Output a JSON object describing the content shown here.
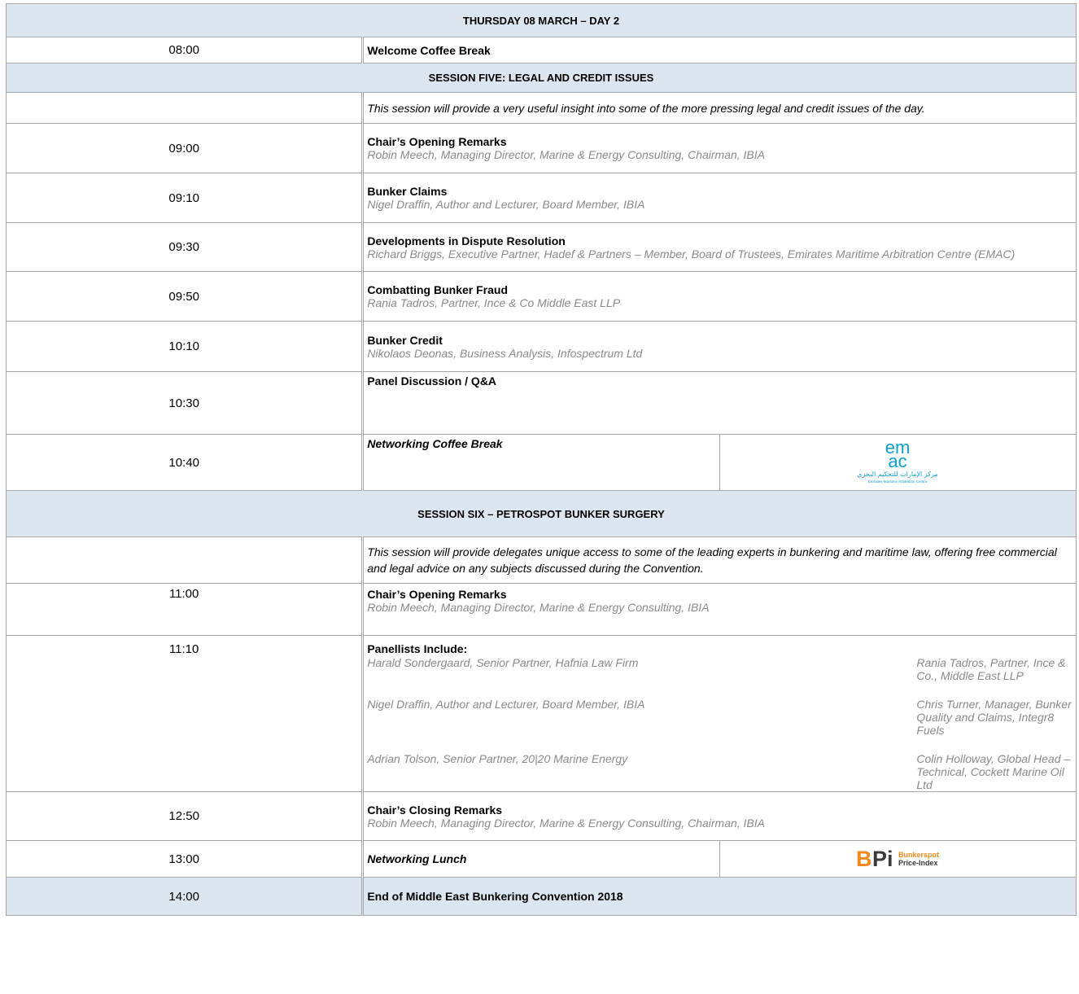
{
  "agenda": {
    "day_header": "THURSDAY 08 MARCH – DAY 2",
    "welcome": {
      "time": "08:00",
      "title": "Welcome Coffee Break"
    },
    "session5": {
      "header": "SESSION FIVE: LEGAL AND CREDIT ISSUES",
      "description": "This session will provide a very useful insight into some of the more pressing legal and credit issues of the day.",
      "items": [
        {
          "time": "09:00",
          "title": "Chair’s Opening Remarks",
          "speaker": "Robin Meech, Managing Director, Marine & Energy Consulting, Chairman, IBIA"
        },
        {
          "time": "09:10",
          "title": "Bunker Claims",
          "speaker": "Nigel Draffin, Author and Lecturer, Board Member, IBIA"
        },
        {
          "time": "09:30",
          "title": "Developments in Dispute Resolution",
          "speaker": "Richard Briggs, Executive Partner, Hadef & Partners – Member, Board of Trustees, Emirates Maritime Arbitration Centre (EMAC)"
        },
        {
          "time": "09:50",
          "title": "Combatting Bunker Fraud",
          "speaker": "Rania Tadros, Partner, Ince & Co Middle East LLP"
        },
        {
          "time": "10:10",
          "title": "Bunker Credit",
          "speaker": "Nikolaos Deonas, Business Analysis, Infospectrum Ltd"
        }
      ],
      "panel": {
        "time": "10:30",
        "title": "Panel Discussion / Q&A"
      },
      "coffee": {
        "time": "10:40",
        "title": "Networking Coffee Break"
      }
    },
    "emac_logo": {
      "letters_top": "em",
      "letters_bottom": "ac",
      "arabic": "مركز الإمارات للتحكيم البحري",
      "english": "Emirates Maritime Arbitration Centre",
      "color": "#0aa0c8"
    },
    "session6": {
      "header": "SESSION SIX – PETROSPOT BUNKER SURGERY",
      "description": "This session will provide delegates unique access to some of the leading experts in bunkering and maritime law, offering free commercial and legal advice on any subjects discussed during the Convention.",
      "opening": {
        "time": "11:00",
        "title": "Chair’s Opening Remarks",
        "speaker": "Robin Meech, Managing Director, Marine & Energy Consulting, IBIA"
      },
      "panellists": {
        "time": "11:10",
        "title": "Panellists Include:",
        "left": [
          "Harald Sondergaard, Senior Partner, Hafnia Law Firm",
          "Nigel Draffin, Author and Lecturer, Board Member, IBIA",
          "Adrian Tolson, Senior Partner, 20|20 Marine Energy"
        ],
        "right": [
          "Rania Tadros, Partner, Ince & Co., Middle East LLP",
          "Chris Turner, Manager, Bunker Quality and Claims, Integr8 Fuels",
          "Colin Holloway, Global Head – Technical, Cockett Marine Oil Ltd"
        ]
      },
      "closing": {
        "time": "12:50",
        "title": "Chair’s Closing Remarks",
        "speaker": "Robin Meech, Managing Director, Marine & Energy Consulting, Chairman, IBIA"
      },
      "lunch": {
        "time": "13:00",
        "title": "Networking Lunch"
      }
    },
    "bpi_logo": {
      "mark_b": "B",
      "mark_pi": "Pi",
      "line1": "Bunkerspot",
      "line2": "Price-Index",
      "color_b": "#f08a1c",
      "color_pi": "#3a3a3a"
    },
    "end": {
      "time": "14:00",
      "title": "End of Middle East Bunkering Convention 2018"
    }
  }
}
